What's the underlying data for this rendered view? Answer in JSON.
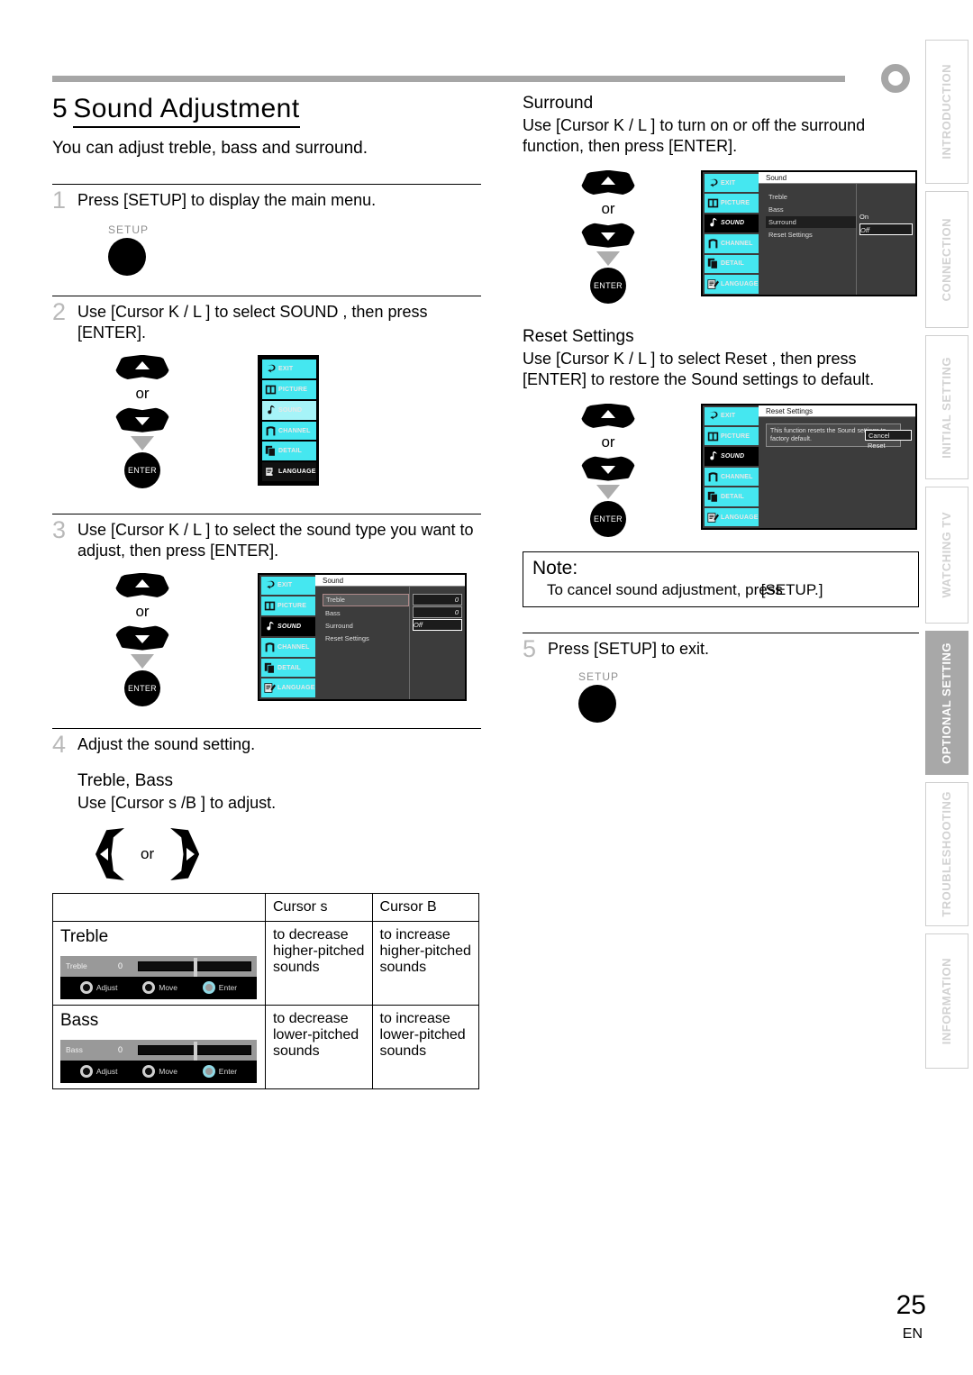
{
  "page": {
    "number": "25",
    "lang": "EN"
  },
  "header": {
    "section_number": "5",
    "title": "Sound Adjustment",
    "subtitle": "You can adjust treble, bass and surround."
  },
  "tabs": [
    {
      "label": "INTRODUCTION",
      "active": false
    },
    {
      "label": "CONNECTION",
      "active": false
    },
    {
      "label": "INITIAL SETTING",
      "active": false
    },
    {
      "label": "WATCHING TV",
      "active": false
    },
    {
      "label": "OPTIONAL SETTING",
      "active": true
    },
    {
      "label": "TROUBLESHOOTING",
      "active": false
    },
    {
      "label": "INFORMATION",
      "active": false
    }
  ],
  "steps": {
    "s1": {
      "num": "1",
      "text": "Press [SETUP] to display the main menu.",
      "key_label": "SETUP"
    },
    "s2": {
      "num": "2",
      "text": "Use [Cursor K / L ] to select  SOUND , then press [ENTER].",
      "or": "or",
      "enter": "ENTER"
    },
    "s3": {
      "num": "3",
      "text": "Use [Cursor K / L ] to select the sound type you want to adjust, then press [ENTER].",
      "or": "or",
      "enter": "ENTER"
    },
    "s4": {
      "num": "4",
      "text": "Adjust the sound setting.",
      "subhead": "Treble, Bass",
      "subtext": "Use [Cursor s /B ] to adjust.",
      "or": "or"
    },
    "s5": {
      "num": "5",
      "text": "Press [SETUP] to exit.",
      "key_label": "SETUP"
    }
  },
  "right": {
    "surround": {
      "head": "Surround",
      "text": "Use [Cursor K / L ] to turn on or off the surround function, then press [ENTER].",
      "or": "or",
      "enter": "ENTER"
    },
    "reset": {
      "head": "Reset Settings",
      "text": "Use [Cursor K / L ] to select  Reset , then press [ENTER] to restore the  Sound  settings to default.",
      "or": "or",
      "enter": "ENTER"
    },
    "note": {
      "title": "Note:",
      "body_a": "To cancel sound adjustment, press",
      "body_b": "[SETUP.]"
    }
  },
  "osd_menu_items": [
    {
      "label": "EXIT",
      "icon": "exit-icon"
    },
    {
      "label": "PICTURE",
      "icon": "picture-icon"
    },
    {
      "label": "SOUND",
      "icon": "sound-icon"
    },
    {
      "label": "CHANNEL",
      "icon": "channel-icon"
    },
    {
      "label": "DETAIL",
      "icon": "detail-icon"
    },
    {
      "label": "LANGUAGE",
      "icon": "language-icon"
    }
  ],
  "osd_sound": {
    "title": "Sound",
    "rows": [
      "Treble",
      "Bass",
      "Surround",
      "Reset Settings"
    ],
    "values": [
      "0",
      "0",
      "Off",
      ""
    ]
  },
  "osd_surround": {
    "title": "Sound",
    "rows": [
      "Treble",
      "Bass",
      "Surround",
      "Reset Settings"
    ],
    "choice_on": "On",
    "choice_off": "Off"
  },
  "osd_reset": {
    "title": "Reset Settings",
    "message": "This function resets the Sound settings to factory default.",
    "choice_cancel": "Cancel",
    "choice_reset": "Reset"
  },
  "cursor_table": {
    "headers": [
      "",
      "Cursor s",
      "Cursor B"
    ],
    "rows": [
      {
        "label": "Treble",
        "slider": {
          "name": "Treble",
          "value": "0",
          "adjust": "Adjust",
          "move": "Move",
          "enter": "Enter"
        },
        "left": "to decrease higher-pitched sounds",
        "right": "to increase higher-pitched sounds"
      },
      {
        "label": "Bass",
        "slider": {
          "name": "Bass",
          "value": "0",
          "adjust": "Adjust",
          "move": "Move",
          "enter": "Enter"
        },
        "left": "to decrease lower-pitched sounds",
        "right": "to increase lower-pitched sounds"
      }
    ]
  },
  "colors": {
    "menu_cyan": "#45e7f0",
    "osd_bg": "#3c3c3c",
    "tab_active": "#a8a8a8",
    "rule_gray": "#a6a6a6"
  }
}
